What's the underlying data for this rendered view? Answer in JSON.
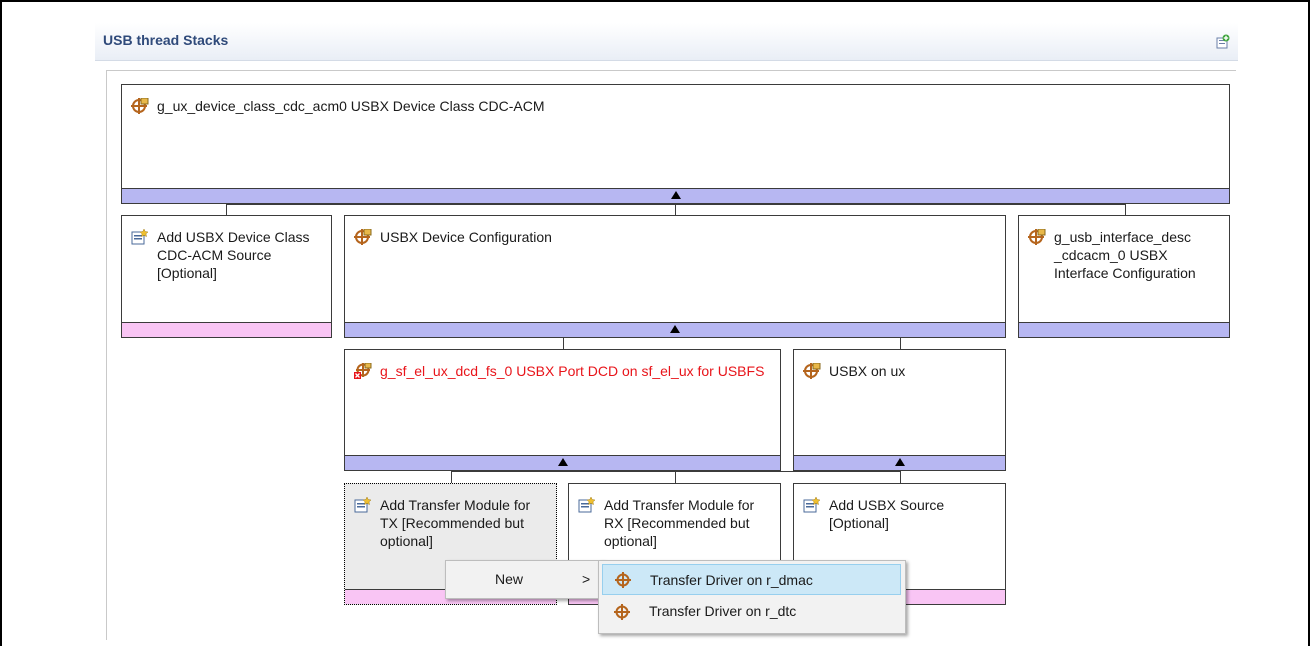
{
  "panel": {
    "title": "USB thread Stacks",
    "add_icon": "add-stack-icon"
  },
  "boxes": {
    "cdc_acm": {
      "label": "g_ux_device_class_cdc_acm0 USBX Device Class CDC-ACM",
      "icon": "module-icon"
    },
    "add_cdc_source": {
      "label": "Add USBX Device Class CDC-ACM Source [Optional]",
      "icon": "add-module-icon"
    },
    "device_config": {
      "label": "USBX Device Configuration",
      "icon": "module-icon"
    },
    "interface_desc": {
      "label": "g_usb_interface_desc _cdcacm_0 USBX Interface Configuration",
      "icon": "module-icon"
    },
    "port_dcd": {
      "label": "g_sf_el_ux_dcd_fs_0 USBX Port DCD on sf_el_ux for USBFS",
      "icon": "module-error-icon",
      "color": "#e8141a"
    },
    "usbx_on_ux": {
      "label": "USBX on ux",
      "icon": "module-icon"
    },
    "transfer_tx": {
      "label": "Add Transfer Module for TX [Recommended but optional]",
      "icon": "add-module-icon"
    },
    "transfer_rx": {
      "label": "Add Transfer Module for RX [Recommended but optional]",
      "icon": "add-module-icon"
    },
    "usbx_source": {
      "label": "Add USBX Source [Optional]",
      "icon": "add-module-icon"
    }
  },
  "context_menu": {
    "new_label": "New",
    "submenu_arrow": ">",
    "items": [
      {
        "label": "Transfer Driver on r_dmac",
        "icon": "module-icon",
        "highlighted": true
      },
      {
        "label": "Transfer Driver on r_dtc",
        "icon": "module-icon",
        "highlighted": false
      }
    ]
  },
  "colors": {
    "expand_bar": "#b7b7f2",
    "optional_bar": "#f9c5f4",
    "error_text": "#e8141a",
    "header_title": "#2f4a7a",
    "menu_highlight": "#cce8f7"
  }
}
